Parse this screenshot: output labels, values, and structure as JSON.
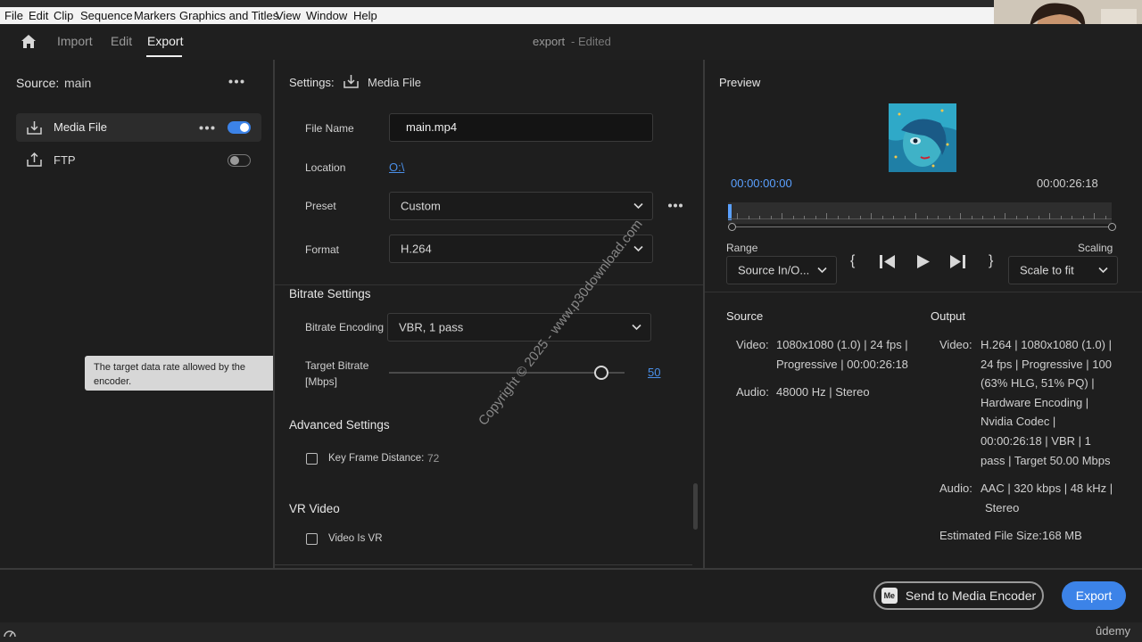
{
  "menubar": [
    "File",
    "Edit",
    "Clip",
    "Sequence",
    "Markers",
    "Graphics and Titles",
    "View",
    "Window",
    "Help"
  ],
  "nav": {
    "tabs": [
      "Import",
      "Edit",
      "Export"
    ],
    "active_tab": "Export",
    "project_name": "export",
    "project_status": "- Edited"
  },
  "source_panel": {
    "label": "Source:",
    "value": "main",
    "destinations": [
      {
        "label": "Media File",
        "enabled": true
      },
      {
        "label": "FTP",
        "enabled": false
      }
    ]
  },
  "settings": {
    "label": "Settings:",
    "destination": "Media File",
    "file_name_label": "File Name",
    "file_name": "main.mp4",
    "location_label": "Location",
    "location": "O:\\",
    "preset_label": "Preset",
    "preset": "Custom",
    "format_label": "Format",
    "format": "H.264",
    "bitrate_section": "Bitrate Settings",
    "bitrate_encoding_label": "Bitrate Encoding",
    "bitrate_encoding": "VBR, 1 pass",
    "target_bitrate_label": "Target Bitrate [Mbps]",
    "target_bitrate_value": "50",
    "target_bitrate_fraction": 0.9,
    "tooltip": "The target data rate allowed by the encoder.",
    "advanced_section": "Advanced Settings",
    "key_frame_label": "Key Frame Distance:",
    "key_frame_value": "72",
    "vr_section": "VR Video",
    "vr_label": "Video Is VR"
  },
  "watermark": "Copyright © 2025 - www.p30download.com",
  "preview": {
    "title": "Preview",
    "timecode_start": "00:00:00:00",
    "timecode_end": "00:00:26:18",
    "range_label": "Range",
    "range_value": "Source In/O...",
    "scaling_label": "Scaling",
    "scaling_value": "Scale to fit"
  },
  "source_info": {
    "title": "Source",
    "video_label": "Video:",
    "video_lines": [
      "1080x1080 (1.0) | 24 fps |",
      "Progressive | 00:00:26:18"
    ],
    "audio_label": "Audio:",
    "audio_lines": [
      "48000 Hz | Stereo"
    ]
  },
  "output_info": {
    "title": "Output",
    "video_label": "Video:",
    "video_lines": [
      "H.264 | 1080x1080 (1.0) |",
      "24 fps | Progressive | 100",
      "(63% HLG, 51% PQ) |",
      "Hardware Encoding |",
      "Nvidia Codec |",
      "00:00:26:18 | VBR | 1",
      "pass | Target 50.00 Mbps"
    ],
    "audio_label": "Audio:",
    "audio_lines": [
      "AAC | 320 kbps | 48 kHz |",
      "Stereo"
    ],
    "estimated_size_label": "Estimated File Size:",
    "estimated_size": "168 MB"
  },
  "footer": {
    "send_to_encoder": "Send to Media Encoder",
    "me_badge": "Me",
    "export": "Export",
    "udemy": "ûdemy"
  },
  "colors": {
    "accent": "#3c83e8",
    "timecode": "#5aa0ff",
    "link": "#4a8fe8"
  }
}
